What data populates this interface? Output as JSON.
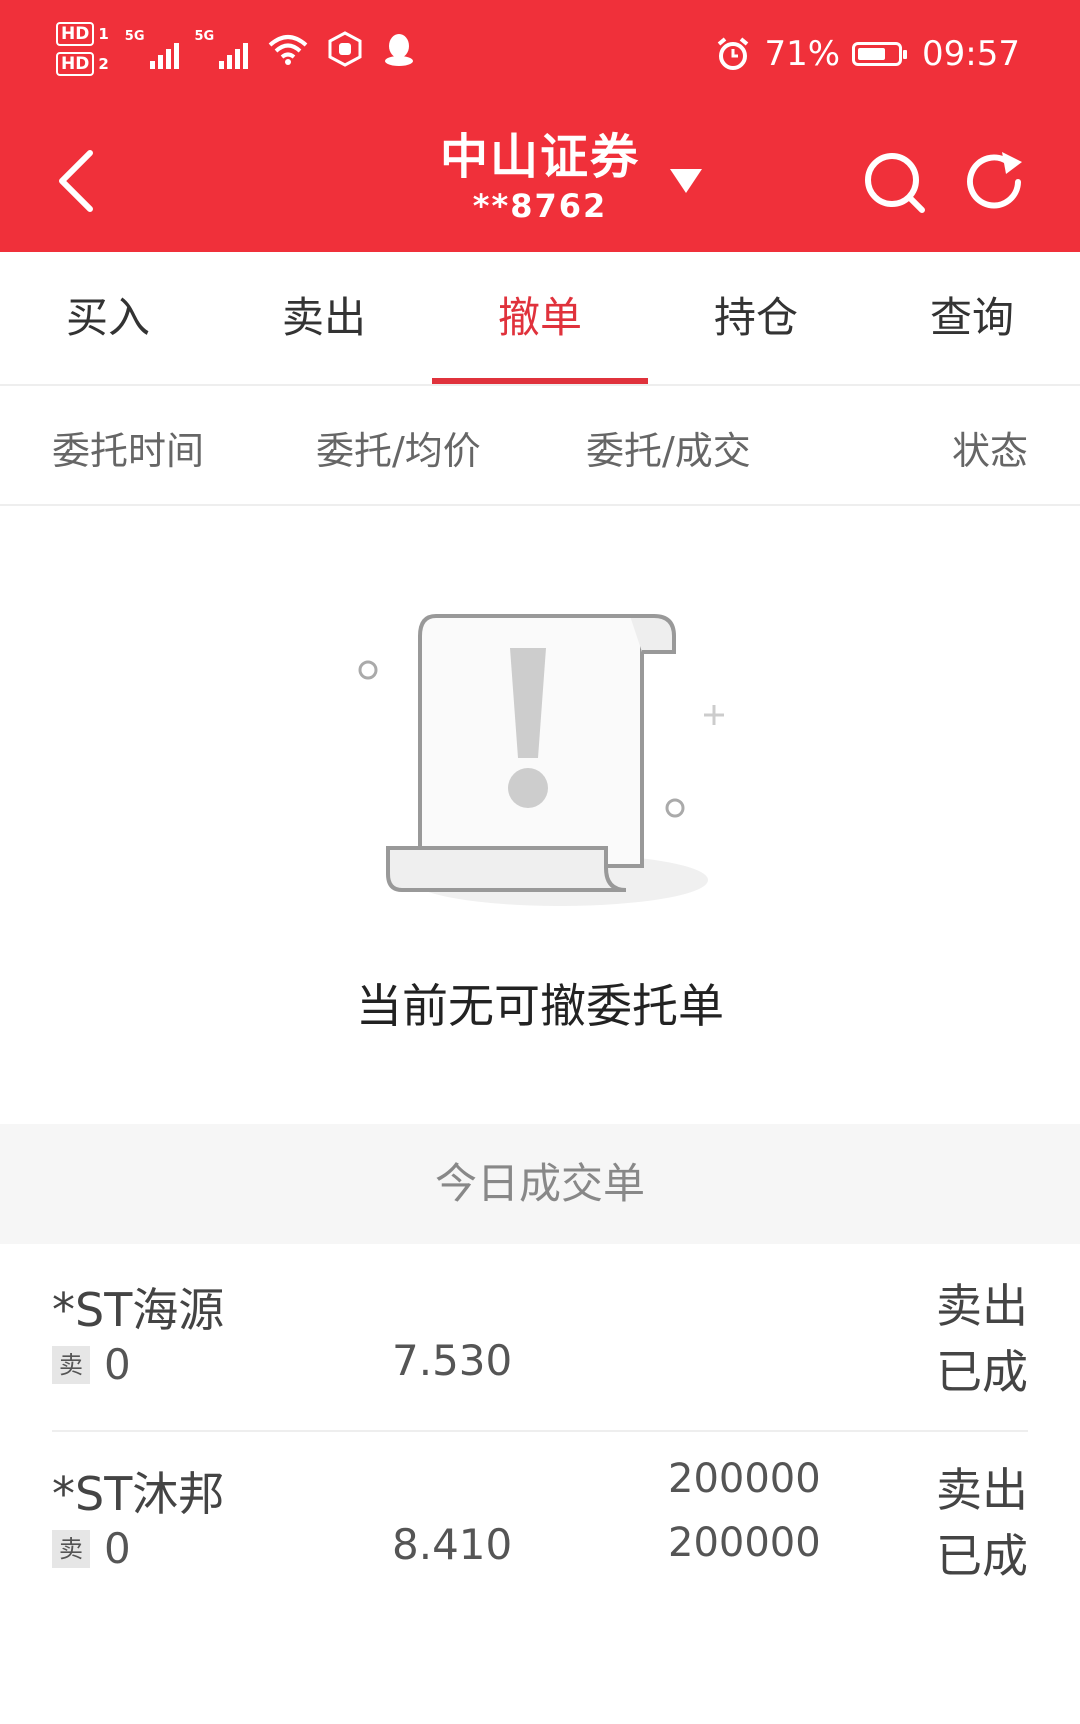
{
  "status_bar": {
    "sim1": "HD",
    "sim1_num": "1",
    "sim2": "HD",
    "sim2_num": "2",
    "net1": "5G",
    "net2": "5G",
    "battery_pct": "71%",
    "battery_level": 0.71,
    "time": "09:57",
    "icons": [
      "signal-icon",
      "wifi-icon",
      "hexagon-hand-icon",
      "qq-icon",
      "alarm-icon",
      "battery-icon"
    ]
  },
  "header": {
    "title": "中山证券",
    "account": "**8762"
  },
  "tabs": [
    {
      "label": "买入"
    },
    {
      "label": "卖出"
    },
    {
      "label": "撤单",
      "active": true
    },
    {
      "label": "持仓"
    },
    {
      "label": "查询"
    }
  ],
  "columns": [
    "委托时间",
    "委托/均价",
    "委托/成交",
    "状态"
  ],
  "empty_state": {
    "text": "当前无可撤委托单"
  },
  "today_section": {
    "title": "今日成交单"
  },
  "trades": [
    {
      "name": "*ST海源",
      "side_badge": "卖",
      "code": "0",
      "price_top": "",
      "price": "7.530",
      "qty_top": "",
      "qty": "",
      "direction": "卖出",
      "status": "已成"
    },
    {
      "name": "*ST沐邦",
      "side_badge": "卖",
      "code": "0",
      "price_top": "",
      "price": "8.410",
      "qty_top": "200000",
      "qty": "200000",
      "direction": "卖出",
      "status": "已成"
    }
  ],
  "colors": {
    "accent": "#f0303a",
    "active_tab": "#e0323c"
  }
}
